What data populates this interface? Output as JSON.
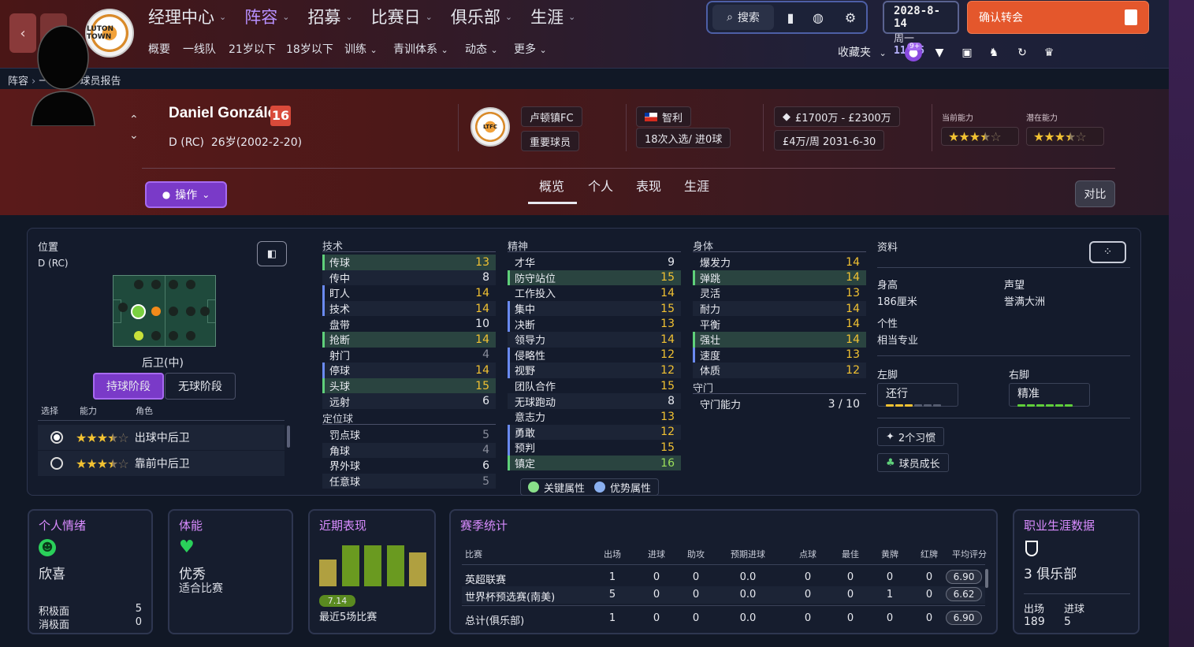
{
  "nav": {
    "back_icon": "chevron-left-icon",
    "forward_icon": "chevron-right-icon",
    "club_crest_text": "LUTON TOWN",
    "main_items": [
      {
        "label": "经理中心"
      },
      {
        "label": "阵容"
      },
      {
        "label": "招募"
      },
      {
        "label": "比赛日"
      },
      {
        "label": "俱乐部"
      },
      {
        "label": "生涯"
      }
    ],
    "sub_items": [
      {
        "label": "概要"
      },
      {
        "label": "一线队"
      },
      {
        "label": "21岁以下"
      },
      {
        "label": "18岁以下"
      },
      {
        "label": "训练"
      },
      {
        "label": "青训体系"
      },
      {
        "label": "动态"
      },
      {
        "label": "更多"
      }
    ],
    "search_label": "搜索",
    "date": "2028-8-14",
    "weekday": "周一",
    "time": "11:15",
    "confirm_transfer_label": "确认转会",
    "favorites_label": "收藏夹",
    "badge_count": "9+"
  },
  "breadcrumb": [
    "阵容",
    "一线队",
    "球员报告"
  ],
  "player": {
    "name": "Daniel González",
    "number": "16",
    "position": "D (RC)",
    "age_birth": "26岁(2002-2-20)",
    "club": "卢顿镇FC",
    "status": "重要球员",
    "nationality": "智利",
    "caps": "18次入选/ 进0球",
    "value": "£1700万 - £2300万",
    "wage_contract": "£4万/周 2031-6-30",
    "current_ability_label": "当前能力",
    "potential_ability_label": "潜在能力",
    "current_ability_stars": 3.5,
    "potential_ability_stars": 3.5
  },
  "tabs": [
    "概览",
    "个人",
    "表现",
    "生涯"
  ],
  "action_label": "操作",
  "compare_label": "对比",
  "position_panel": {
    "title": "位置",
    "position": "D (RC)",
    "role_name": "后卫(中)",
    "phase_in": "持球阶段",
    "phase_out": "无球阶段",
    "col_select": "选择",
    "col_ability": "能力",
    "col_role": "角色",
    "roles": [
      {
        "name": "出球中后卫",
        "stars": 3.5,
        "selected": true
      },
      {
        "name": "靠前中后卫",
        "stars": 3.5,
        "selected": false
      }
    ]
  },
  "technical": {
    "title": "技术",
    "attrs": [
      {
        "name": "传球",
        "value": 13,
        "key": true,
        "pref": false,
        "color": "c1"
      },
      {
        "name": "传中",
        "value": 8,
        "key": false,
        "pref": false,
        "color": "c3"
      },
      {
        "name": "盯人",
        "value": 14,
        "key": false,
        "pref": true,
        "color": "c1"
      },
      {
        "name": "技术",
        "value": 14,
        "key": false,
        "pref": true,
        "color": "c1"
      },
      {
        "name": "盘带",
        "value": 10,
        "key": false,
        "pref": false,
        "color": "c3"
      },
      {
        "name": "抢断",
        "value": 14,
        "key": true,
        "pref": false,
        "color": "c1"
      },
      {
        "name": "射门",
        "value": 4,
        "key": false,
        "pref": false,
        "color": "c4"
      },
      {
        "name": "停球",
        "value": 14,
        "key": false,
        "pref": true,
        "color": "c1"
      },
      {
        "name": "头球",
        "value": 15,
        "key": true,
        "pref": false,
        "color": "c1"
      },
      {
        "name": "远射",
        "value": 6,
        "key": false,
        "pref": false,
        "color": "c3"
      }
    ]
  },
  "set_pieces": {
    "title": "定位球",
    "attrs": [
      {
        "name": "罚点球",
        "value": 5,
        "color": "c4"
      },
      {
        "name": "角球",
        "value": 4,
        "color": "c4"
      },
      {
        "name": "界外球",
        "value": 6,
        "color": "c3"
      },
      {
        "name": "任意球",
        "value": 5,
        "color": "c4"
      }
    ]
  },
  "mental": {
    "title": "精神",
    "attrs": [
      {
        "name": "才华",
        "value": 9,
        "key": false,
        "pref": false,
        "color": "c3"
      },
      {
        "name": "防守站位",
        "value": 15,
        "key": true,
        "pref": false,
        "color": "c1"
      },
      {
        "name": "工作投入",
        "value": 14,
        "key": false,
        "pref": false,
        "color": "c1"
      },
      {
        "name": "集中",
        "value": 15,
        "key": false,
        "pref": true,
        "color": "c1"
      },
      {
        "name": "决断",
        "value": 13,
        "key": false,
        "pref": true,
        "color": "c1"
      },
      {
        "name": "领导力",
        "value": 14,
        "key": false,
        "pref": false,
        "color": "c1"
      },
      {
        "name": "侵略性",
        "value": 12,
        "key": false,
        "pref": true,
        "color": "c1"
      },
      {
        "name": "视野",
        "value": 12,
        "key": false,
        "pref": true,
        "color": "c1"
      },
      {
        "name": "团队合作",
        "value": 15,
        "key": false,
        "pref": false,
        "color": "c1"
      },
      {
        "name": "无球跑动",
        "value": 8,
        "key": false,
        "pref": false,
        "color": "c3"
      },
      {
        "name": "意志力",
        "value": 13,
        "key": false,
        "pref": false,
        "color": "c1"
      },
      {
        "name": "勇敢",
        "value": 12,
        "key": false,
        "pref": true,
        "color": "c1"
      },
      {
        "name": "预判",
        "value": 15,
        "key": false,
        "pref": true,
        "color": "c1"
      },
      {
        "name": "镇定",
        "value": 16,
        "key": true,
        "pref": false,
        "color": "c2"
      }
    ]
  },
  "physical": {
    "title": "身体",
    "attrs": [
      {
        "name": "爆发力",
        "value": 14,
        "key": false,
        "pref": false,
        "color": "c1"
      },
      {
        "name": "弹跳",
        "value": 14,
        "key": true,
        "pref": false,
        "color": "c1"
      },
      {
        "name": "灵活",
        "value": 13,
        "key": false,
        "pref": false,
        "color": "c1"
      },
      {
        "name": "耐力",
        "value": 14,
        "key": false,
        "pref": false,
        "color": "c1"
      },
      {
        "name": "平衡",
        "value": 14,
        "key": false,
        "pref": false,
        "color": "c1"
      },
      {
        "name": "强壮",
        "value": 14,
        "key": true,
        "pref": false,
        "color": "c1"
      },
      {
        "name": "速度",
        "value": 13,
        "key": false,
        "pref": true,
        "color": "c1"
      },
      {
        "name": "体质",
        "value": 12,
        "key": false,
        "pref": false,
        "color": "c1"
      }
    ]
  },
  "goalkeeping": {
    "title": "守门",
    "label": "守门能力",
    "value": "3 / 10"
  },
  "legend": {
    "key": "关键属性",
    "pref": "优势属性"
  },
  "info": {
    "title": "资料",
    "height_label": "身高",
    "height": "186厘米",
    "rep_label": "声望",
    "rep": "誉满大洲",
    "personality_label": "个性",
    "personality": "相当专业",
    "left_foot_label": "左脚",
    "left_foot": "还行",
    "right_foot_label": "右脚",
    "right_foot": "精准",
    "habits": "2个习惯",
    "development": "球员成长"
  },
  "cards": {
    "morale": {
      "title": "个人情绪",
      "state": "欣喜",
      "pos_label": "积极面",
      "pos": "5",
      "neg_label": "消极面",
      "neg": "0"
    },
    "fitness": {
      "title": "体能",
      "state": "优秀",
      "sub": "适合比赛"
    },
    "form": {
      "title": "近期表现",
      "avg": "7.14",
      "sub": "最近5场比赛",
      "bars": [
        6.5,
        7.3,
        7.3,
        7.3,
        6.9
      ]
    },
    "season": {
      "title": "赛季统计",
      "headers": [
        "比赛",
        "出场",
        "进球",
        "助攻",
        "预期进球",
        "点球",
        "最佳",
        "黄牌",
        "红牌",
        "平均评分"
      ],
      "rows": [
        [
          "英超联赛",
          "1",
          "0",
          "0",
          "0.0",
          "0",
          "0",
          "0",
          "0",
          "6.90"
        ],
        [
          "世界杯预选赛(南美)",
          "5",
          "0",
          "0",
          "0.0",
          "0",
          "0",
          "1",
          "0",
          "6.62"
        ]
      ],
      "total": [
        "总计(俱乐部)",
        "1",
        "0",
        "0",
        "0.0",
        "0",
        "0",
        "0",
        "0",
        "6.90"
      ]
    },
    "career": {
      "title": "职业生涯数据",
      "clubs": "3 俱乐部",
      "apps_label": "出场",
      "apps": "189",
      "goals_label": "进球",
      "goals": "5"
    }
  },
  "colors": {
    "accent": "#7a3ac8",
    "confirm": "#e4572c",
    "key_attr": "#5fd07a",
    "pref_attr": "#6a8af0",
    "star": "#f2c232"
  }
}
